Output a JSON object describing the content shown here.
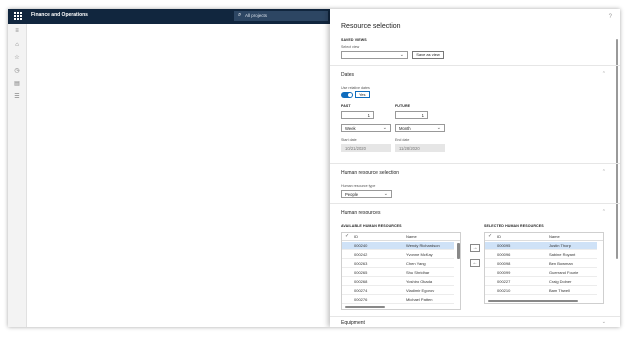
{
  "app": {
    "name": "Finance and Operations",
    "search_placeholder": "All projects"
  },
  "leftnav": {
    "icons": [
      "hamburger-icon",
      "home-icon",
      "star-icon",
      "clock-icon",
      "workspace-icon",
      "list-icon"
    ]
  },
  "panel": {
    "title": "Resource selection",
    "help": "?",
    "saved_views": {
      "heading": "SAVED VIEWS",
      "select_label": "Select view",
      "select_value": "",
      "save_button": "Save as view"
    },
    "dates": {
      "heading": "Dates",
      "relative_label": "Use relative dates",
      "relative_value": "Yes",
      "past_heading": "PAST",
      "future_heading": "FUTURE",
      "past_count": "1",
      "future_count": "1",
      "past_unit": "Week",
      "future_unit": "Month",
      "start_label": "Start date",
      "end_label": "End date",
      "start_value": "10/21/2020",
      "end_value": "11/28/2020"
    },
    "hr_selection": {
      "heading": "Human resource selection",
      "type_label": "Human resource type",
      "type_value": "People"
    },
    "human_resources": {
      "heading": "Human resources",
      "available_heading": "AVAILABLE HUMAN RESOURCES",
      "selected_heading": "SELECTED HUMAN RESOURCES",
      "col_id": "ID",
      "col_name": "Name",
      "available": [
        {
          "id": "000240",
          "name": "Wendy Richardson",
          "selected": true
        },
        {
          "id": "000242",
          "name": "Yvonne McKay",
          "selected": false
        },
        {
          "id": "000263",
          "name": "Chen Yang",
          "selected": false
        },
        {
          "id": "000265",
          "name": "Shu Shridhar",
          "selected": false
        },
        {
          "id": "000268",
          "name": "Yoshiro Okada",
          "selected": false
        },
        {
          "id": "000274",
          "name": "Vladimir Egorov",
          "selected": false
        },
        {
          "id": "000276",
          "name": "Michael Patten",
          "selected": false
        }
      ],
      "selected": [
        {
          "id": "000095",
          "name": "Justin Thorp",
          "selected": true
        },
        {
          "id": "000096",
          "name": "Sabine Royant",
          "selected": false
        },
        {
          "id": "000098",
          "name": "Ben Bowman",
          "selected": false
        },
        {
          "id": "000099",
          "name": "Guerrand Fourie",
          "selected": false
        },
        {
          "id": "000227",
          "name": "Craig Dolner",
          "selected": false
        },
        {
          "id": "000210",
          "name": "Bam Thwell",
          "selected": false
        }
      ],
      "move_right": "→",
      "move_left": "←"
    },
    "equipment": {
      "heading": "Equipment"
    }
  }
}
